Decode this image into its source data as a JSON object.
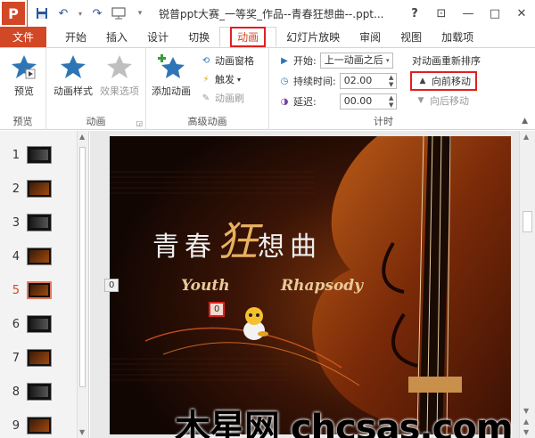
{
  "titlebar": {
    "app_badge": "P",
    "title": "锐普ppt大赛_一等奖_作品--青春狂想曲--.ppt...",
    "help": "?",
    "restore_ribbon": "⊡",
    "minimize": "—",
    "maximize": "□",
    "close": "✕"
  },
  "tabs": {
    "file": "文件",
    "items": [
      "开始",
      "插入",
      "设计",
      "切换",
      "动画",
      "幻灯片放映",
      "审阅",
      "视图",
      "加载项"
    ],
    "active_index": 4
  },
  "ribbon": {
    "preview_group": {
      "preview_label": "预览",
      "group_label": "预览"
    },
    "animation_group": {
      "style_label": "动画样式",
      "effect_label": "效果选项",
      "group_label": "动画"
    },
    "advanced_group": {
      "add_label": "添加动画",
      "pane_label": "动画窗格",
      "trigger_label": "触发",
      "painter_label": "动画刷",
      "group_label": "高级动画"
    },
    "timing_group": {
      "start_label": "开始:",
      "start_value": "上一动画之后",
      "duration_label": "持续时间:",
      "duration_value": "02.00",
      "delay_label": "延迟:",
      "delay_value": "00.00",
      "reorder_label": "对动画重新排序",
      "move_earlier": "向前移动",
      "move_later": "向后移动",
      "group_label": "计时"
    }
  },
  "slides": {
    "numbers": [
      "1",
      "2",
      "3",
      "4",
      "5",
      "6",
      "7",
      "8",
      "9"
    ],
    "selected_index": 4
  },
  "slide": {
    "title_part1": "青春",
    "title_emph": "狂",
    "title_part2": "想曲",
    "subtitle_left": "Youth",
    "subtitle_right": "Rhapsody",
    "anim_tag_left": "0",
    "anim_tag_selected": "0"
  },
  "watermark": "木星网 chcsas.com",
  "colors": {
    "accent": "#d24726",
    "highlight_box": "#e02020",
    "title_emph": "#e8b060"
  }
}
